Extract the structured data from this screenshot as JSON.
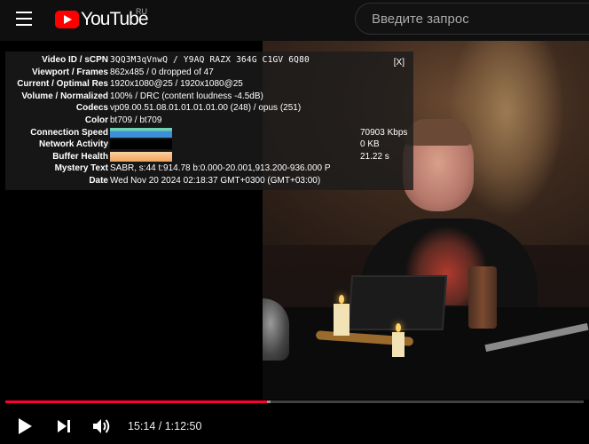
{
  "header": {
    "logo_text": "YouTube",
    "logo_region": "RU",
    "search_placeholder": "Введите запрос"
  },
  "stats": {
    "close_label": "[X]",
    "rows": [
      {
        "label": "Video ID / sCPN",
        "value": "3QQ3M3qVnwQ  /  Y9AQ  RAZX  364G  C1GV  6Q80"
      },
      {
        "label": "Viewport / Frames",
        "value": "862x485 / 0 dropped of 47"
      },
      {
        "label": "Current / Optimal Res",
        "value": "1920x1080@25 / 1920x1080@25"
      },
      {
        "label": "Volume / Normalized",
        "value": "100% / DRC (content loudness -4.5dB)"
      },
      {
        "label": "Codecs",
        "value": "vp09.00.51.08.01.01.01.01.00 (248) / opus (251)"
      },
      {
        "label": "Color",
        "value": "bt709 / bt709"
      },
      {
        "label": "Connection Speed",
        "value": "70903 Kbps"
      },
      {
        "label": "Network Activity",
        "value": "0 KB"
      },
      {
        "label": "Buffer Health",
        "value": "21.22 s"
      },
      {
        "label": "Mystery Text",
        "value": "SABR, s:44 t:914.78 b:0.000-20.001,913.200-936.000 P"
      },
      {
        "label": "Date",
        "value": "Wed Nov 20 2024 02:18:37 GMT+0300 (GMT+03:00)"
      }
    ],
    "graph_colors": {
      "connection": "#3d8fd8",
      "connection_top": "#6fd1b3",
      "network": "#000000",
      "buffer": "#f7b97a"
    }
  },
  "player": {
    "time_current": "15:14",
    "time_separator": " / ",
    "time_total": "1:12:50",
    "played_fraction": 0.452,
    "loaded_fraction": 0.458,
    "accent_color": "#ff0033"
  },
  "icons": {
    "menu": "menu-icon",
    "play": "play-icon",
    "next": "next-icon",
    "volume": "volume-icon"
  }
}
